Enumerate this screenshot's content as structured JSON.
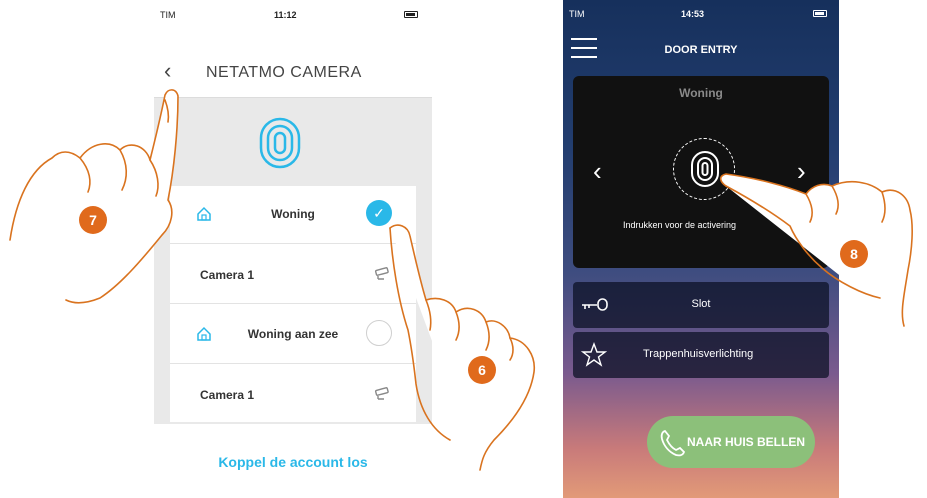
{
  "left_phone": {
    "status": {
      "carrier": "TIM",
      "time": "11:12"
    },
    "nav": {
      "back": "‹",
      "title": "NETATMO CAMERA"
    },
    "rows": [
      {
        "label": "Woning",
        "selected": true
      },
      {
        "label": "Camera 1"
      },
      {
        "label": "Woning aan zee",
        "selected": false
      },
      {
        "label": "Camera 1"
      }
    ],
    "check_glyph": "✓",
    "unlink_label": "Koppel de account los"
  },
  "right_phone": {
    "status": {
      "carrier": "TIM",
      "time": "14:53"
    },
    "title": "DOOR ENTRY",
    "card": {
      "location": "Woning",
      "prev": "‹",
      "next": "›",
      "hint": "Indrukken voor de activering"
    },
    "actions": [
      {
        "label": "Slot",
        "icon": "key-icon"
      },
      {
        "label": "Trappenhuisverlichting",
        "icon": "star-icon"
      }
    ],
    "call_label": "NAAR HUIS BELLEN"
  },
  "callouts": [
    "7",
    "6",
    "8"
  ],
  "colors": {
    "accent_blue": "#2ab8e8",
    "callout_orange": "#e06a1c",
    "call_green": "#8cc07a"
  }
}
